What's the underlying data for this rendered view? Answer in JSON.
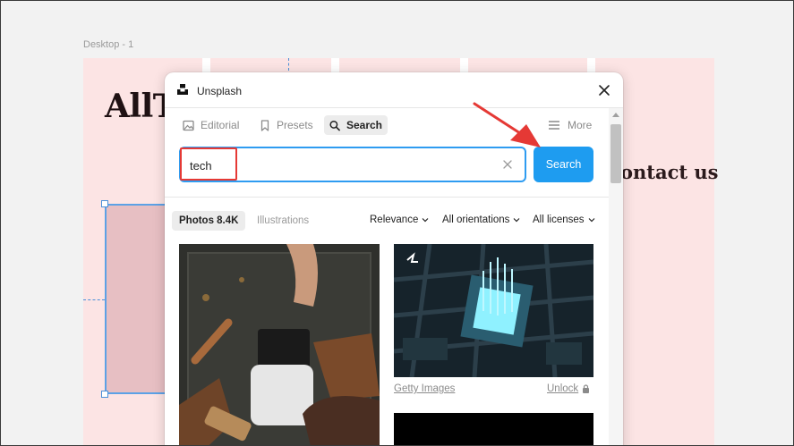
{
  "frame": {
    "label": "Desktop - 1"
  },
  "site": {
    "logo_text": "AllT",
    "nav_item": "ontact us"
  },
  "plugin": {
    "title": "Unsplash",
    "tabs": [
      {
        "label": "Editorial",
        "icon": "image-icon"
      },
      {
        "label": "Presets",
        "icon": "bookmark-icon"
      },
      {
        "label": "Search",
        "icon": "search-icon",
        "active": true
      }
    ],
    "more_label": "More",
    "search": {
      "value": "tech",
      "button_label": "Search"
    },
    "filters": {
      "photos_label": "Photos 8.4K",
      "illustrations_label": "Illustrations",
      "sort_label": "Relevance",
      "orientation_label": "All orientations",
      "license_label": "All licenses"
    },
    "results": [
      {
        "description": "hands holding a card reader over a leather workshop table"
      },
      {
        "description": "glowing microchip on a circuit board",
        "credit": "Getty Images",
        "action": "Unlock"
      },
      {
        "description": "dark photo"
      }
    ]
  },
  "colors": {
    "canvas": "#fce4e4",
    "accent": "#1e9cf0",
    "annotation": "#e53935",
    "selection": "#5ca1e6"
  }
}
